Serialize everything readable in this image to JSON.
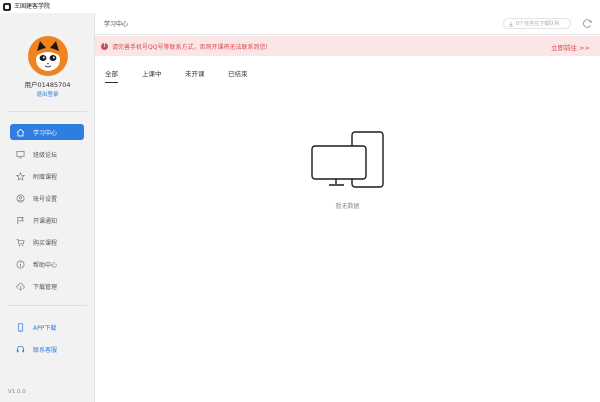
{
  "app": {
    "title": "王国建客学院"
  },
  "sidebar": {
    "username": "用户01485704",
    "logout": "退出登录",
    "items": [
      {
        "label": "学习中心",
        "icon": "home-icon"
      },
      {
        "label": "班级论坛",
        "icon": "monitor-icon"
      },
      {
        "label": "附赠课程",
        "icon": "star-icon"
      },
      {
        "label": "账号设置",
        "icon": "user-icon"
      },
      {
        "label": "开课通知",
        "icon": "flag-icon"
      },
      {
        "label": "购买课程",
        "icon": "cart-icon"
      },
      {
        "label": "帮助中心",
        "icon": "info-icon"
      },
      {
        "label": "下载管理",
        "icon": "cloud-download-icon"
      }
    ],
    "extra": [
      {
        "label": "APP下载",
        "icon": "phone-icon"
      },
      {
        "label": "联系客服",
        "icon": "headset-icon"
      }
    ],
    "version": "V1.0.0"
  },
  "header": {
    "title": "学习中心",
    "queue": "0个任务在下载队列"
  },
  "alert": {
    "text": "请完善手机号QQ号等联系方式，否则开课将无法联系到您!",
    "link": "立即前往 >>"
  },
  "tabs": [
    "全部",
    "上课中",
    "未开课",
    "已结束"
  ],
  "empty": {
    "text": "暂无数据"
  },
  "colors": {
    "accent": "#2f7de1",
    "alert_bg": "#fae6e6",
    "alert_text": "#d94a4a",
    "avatar_bg": "#f0831e"
  }
}
